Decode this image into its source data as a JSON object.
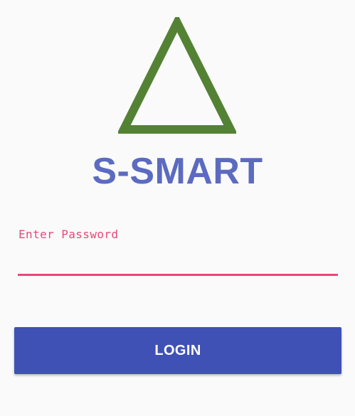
{
  "app": {
    "title": "S-SMART",
    "logo_icon": "triangle-outline-icon"
  },
  "login_form": {
    "password_label": "Enter Password",
    "password_value": "",
    "login_label": "LOGIN"
  },
  "colors": {
    "background": "#fafafa",
    "logo_green": "#548235",
    "title_blue": "#5c6bc0",
    "accent_pink": "#e8487a",
    "button_blue": "#3f51b5"
  }
}
